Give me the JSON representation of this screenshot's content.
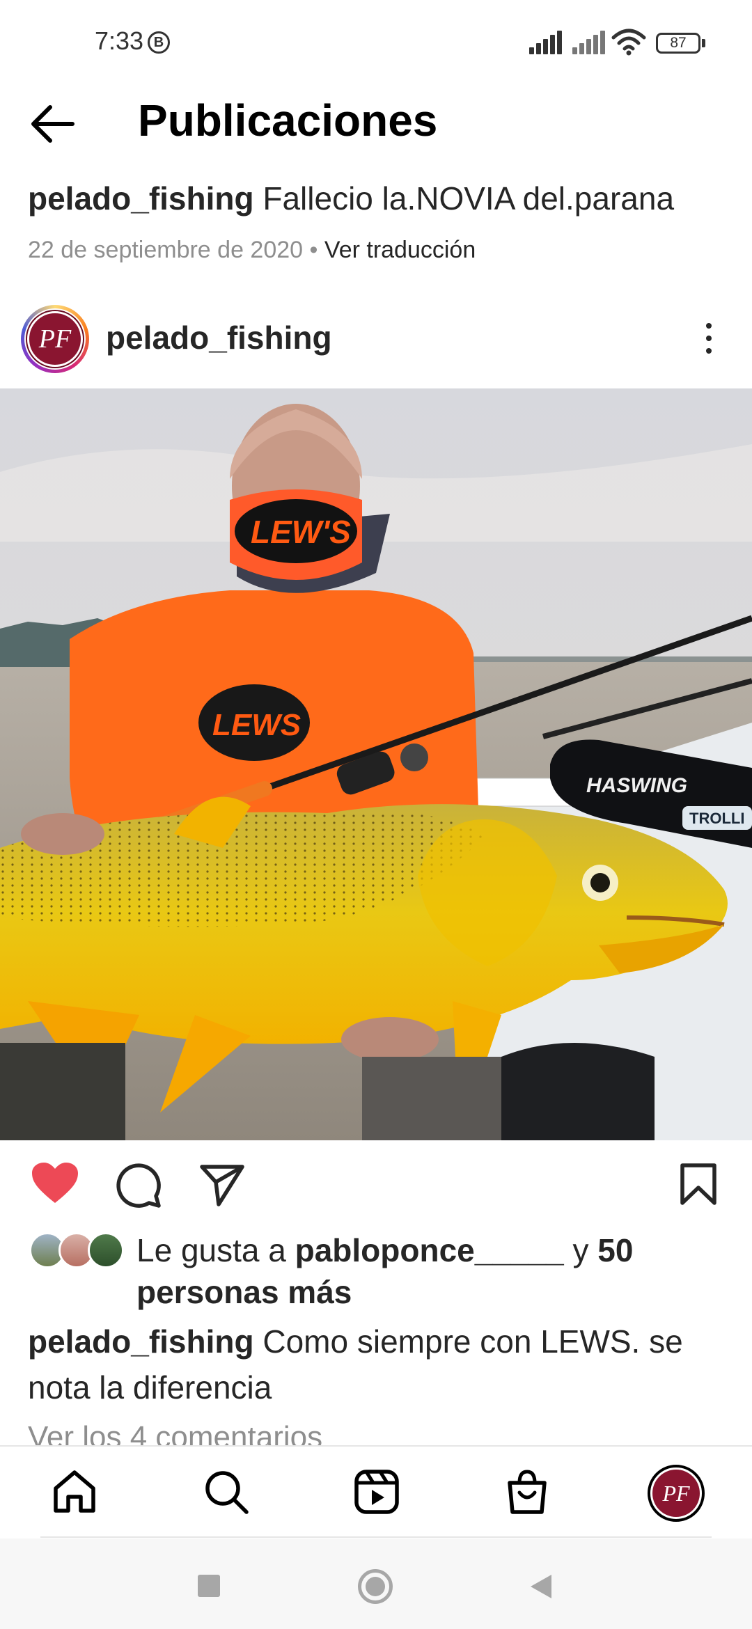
{
  "status_bar": {
    "time": "7:33",
    "b_badge": "B",
    "battery": "87",
    "icons": [
      "signal-icon",
      "signal-icon",
      "wifi-icon",
      "battery-icon"
    ]
  },
  "header": {
    "title": "Publicaciones",
    "back_icon": "arrow-left-icon"
  },
  "top_caption": {
    "username": "pelado_fishing",
    "text": "Fallecio la.NOVIA del.parana"
  },
  "meta": {
    "date": "22 de septiembre de 2020",
    "separator": "•",
    "translate": "Ver traducción"
  },
  "post": {
    "username": "pelado_fishing",
    "avatar_letters": "PF",
    "more_icon": "more-vertical-icon",
    "mask_text": "LEW'S",
    "shirt_text": "LEWS",
    "boat_text": "HASWING",
    "boat_text_2": "TROLLI"
  },
  "actions": {
    "liked": true,
    "icons": [
      "heart-icon",
      "comment-icon",
      "send-icon",
      "bookmark-icon"
    ]
  },
  "likes": {
    "prefix": "Le gusta a",
    "user": "pabloponce_____",
    "connector": "y",
    "count_text": "50 personas más"
  },
  "caption": {
    "username": "pelado_fishing",
    "text": "Como siempre con LEWS. se nota la diferencia"
  },
  "comments_link": "Ver los 4 comentarios",
  "bottom_nav": {
    "items": [
      "home-icon",
      "search-icon",
      "reels-icon",
      "shop-icon",
      "profile-avatar"
    ]
  },
  "colors": {
    "accent_heart": "#ed4956",
    "text": "#262626",
    "muted": "#8e8e8e",
    "avatar_bg": "#8a1530"
  }
}
